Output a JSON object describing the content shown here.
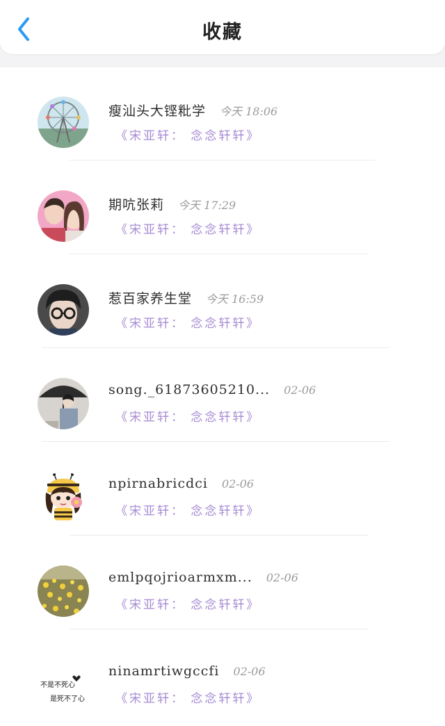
{
  "header": {
    "title": "收藏",
    "back_icon": "chevron-left-icon",
    "accent": "#2b9af3"
  },
  "items": [
    {
      "name": "瘦汕头大铿粃学",
      "time": "今天 18:06",
      "quote": "《宋亚轩： 念念轩轩》",
      "avatar": "ferris-wheel-photo"
    },
    {
      "name": "期吭张莉",
      "time": "今天 17:29",
      "quote": "《宋亚轩： 念念轩轩》",
      "avatar": "couple-photo"
    },
    {
      "name": "惹百家养生堂",
      "time": "今天 16:59",
      "quote": "《宋亚轩： 念念轩轩》",
      "avatar": "glasses-boy-photo"
    },
    {
      "name": "song._61873605210...",
      "time": "02-06",
      "quote": "《宋亚轩： 念念轩轩》",
      "avatar": "umbrella-photo"
    },
    {
      "name": "npirnabricdci",
      "time": "02-06",
      "quote": "《宋亚轩： 念念轩轩》",
      "avatar": "bee-girl-cartoon"
    },
    {
      "name": "emlpqojrioarmxm...",
      "time": "02-06",
      "quote": "《宋亚轩： 念念轩轩》",
      "avatar": "yellow-flowers-photo"
    },
    {
      "name": "ninamrtiwgccfi",
      "time": "02-06",
      "quote": "《宋亚轩： 念念轩轩》",
      "avatar": "text-avatar",
      "avatar_text": [
        "不是不死心",
        "是死不了心"
      ]
    }
  ],
  "colors": {
    "quote": "#a78bd4",
    "name": "#2d2d2d",
    "time": "#9a9a9a"
  }
}
